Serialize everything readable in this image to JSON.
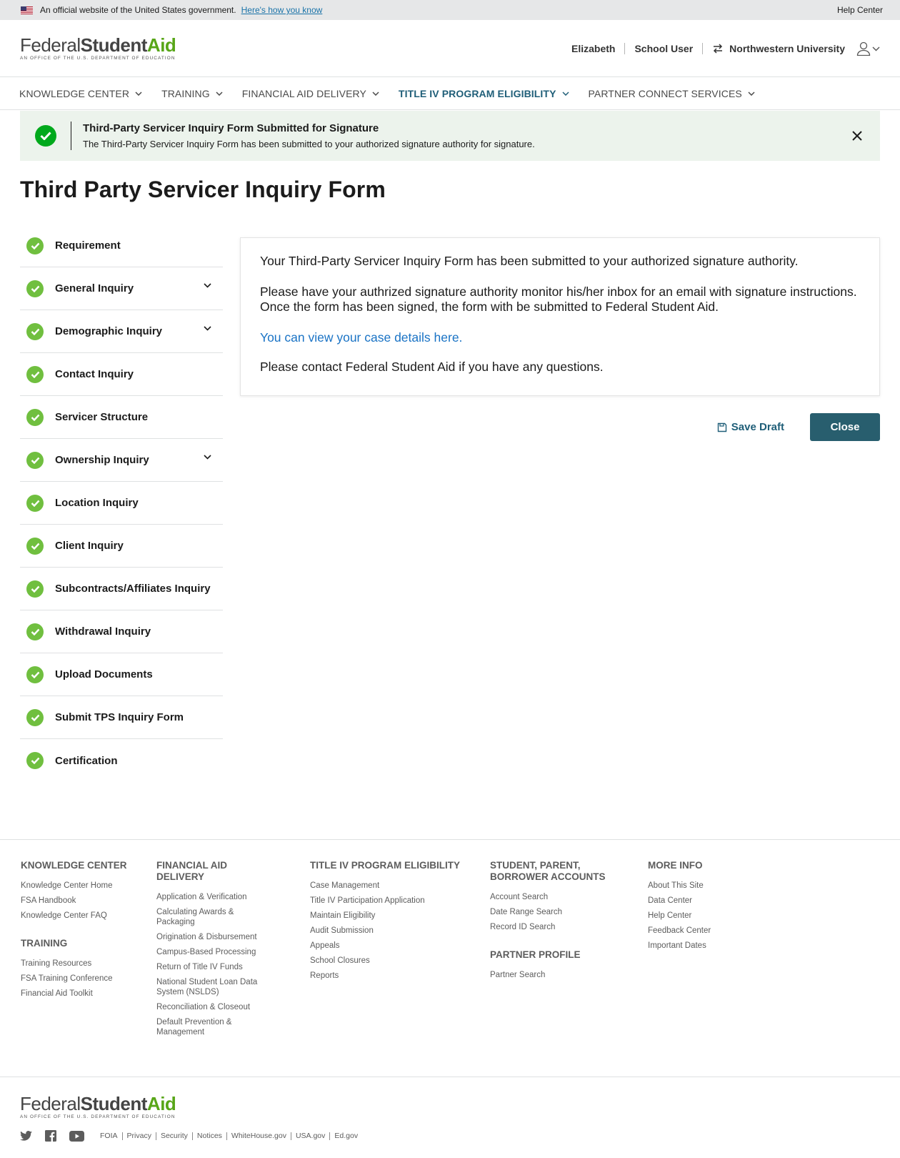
{
  "gov_banner": {
    "text": "An official website of the United States government.",
    "how_link": "Here's how you know",
    "help": "Help Center"
  },
  "logo": {
    "federal": "Federal",
    "student": "Student",
    "aid": "Aid",
    "subtitle": "An Office of the U.S. Department of Education"
  },
  "header": {
    "user": "Elizabeth",
    "role": "School User",
    "institution": "Northwestern University"
  },
  "nav": [
    {
      "label": "Knowledge Center"
    },
    {
      "label": "Training"
    },
    {
      "label": "Financial Aid Delivery"
    },
    {
      "label": "Title IV Program Eligibility",
      "active": true
    },
    {
      "label": "Partner Connect Services"
    }
  ],
  "alert": {
    "title": "Third-Party Servicer Inquiry Form Submitted for Signature",
    "body": "The Third-Party Servicer Inquiry Form has been submitted to your authorized signature authority for signature."
  },
  "page_title": "Third Party Servicer Inquiry Form",
  "steps": [
    {
      "label": "Requirement",
      "expandable": false
    },
    {
      "label": "General Inquiry",
      "expandable": true
    },
    {
      "label": "Demographic Inquiry",
      "expandable": true
    },
    {
      "label": "Contact Inquiry",
      "expandable": false
    },
    {
      "label": "Servicer Structure",
      "expandable": false
    },
    {
      "label": "Ownership Inquiry",
      "expandable": true
    },
    {
      "label": "Location Inquiry",
      "expandable": false
    },
    {
      "label": "Client Inquiry",
      "expandable": false
    },
    {
      "label": "Subcontracts/Affiliates Inquiry",
      "expandable": false
    },
    {
      "label": "Withdrawal Inquiry",
      "expandable": false
    },
    {
      "label": "Upload Documents",
      "expandable": false
    },
    {
      "label": "Submit TPS Inquiry Form",
      "expandable": false
    },
    {
      "label": "Certification",
      "expandable": false
    }
  ],
  "card": {
    "p1": "Your Third-Party Servicer Inquiry Form has been submitted to your authorized signature authority.",
    "p2": "Please have your authrized signature authority monitor his/her inbox for an email with signature instructions. Once the form has been signed, the form with be submitted to Federal Student Aid.",
    "link": "You can view your case details here.",
    "p3": "Please contact Federal Student Aid if you have any questions."
  },
  "actions": {
    "save_draft": "Save Draft",
    "close": "Close"
  },
  "footer": {
    "columns": [
      {
        "sections": [
          {
            "heading": "Knowledge Center",
            "links": [
              "Knowledge Center Home",
              "FSA Handbook",
              "Knowledge Center FAQ"
            ]
          },
          {
            "heading": "Training",
            "links": [
              "Training Resources",
              "FSA Training Conference",
              "Financial Aid Toolkit"
            ]
          }
        ]
      },
      {
        "sections": [
          {
            "heading": "Financial Aid Delivery",
            "links": [
              "Application & Verification",
              "Calculating Awards & Packaging",
              "Origination & Disbursement",
              "Campus-Based Processing",
              "Return of Title IV Funds",
              "National Student Loan Data System (NSLDS)",
              "Reconciliation & Closeout",
              "Default Prevention & Management"
            ]
          }
        ]
      },
      {
        "sections": [
          {
            "heading": "Title IV Program Eligibility",
            "links": [
              "Case Management",
              "Title IV Participation Application",
              "Maintain Eligibility",
              "Audit Submission",
              "Appeals",
              "School Closures",
              "Reports"
            ]
          }
        ]
      },
      {
        "sections": [
          {
            "heading": "Student, Parent, Borrower Accounts",
            "links": [
              "Account Search",
              "Date Range Search",
              "Record ID Search"
            ]
          },
          {
            "heading": "Partner Profile",
            "links": [
              "Partner Search"
            ]
          }
        ]
      },
      {
        "sections": [
          {
            "heading": "More Info",
            "links": [
              "About This Site",
              "Data Center",
              "Help Center",
              "Feedback Center",
              "Important Dates"
            ]
          }
        ]
      }
    ],
    "bottom_links": [
      "FOIA",
      "Privacy",
      "Security",
      "Notices",
      "WhiteHouse.gov",
      "USA.gov",
      "Ed.gov"
    ]
  },
  "colors": {
    "brand_green": "#58a618",
    "primary": "#285e6e",
    "link": "#1a73c5",
    "success": "#70bf3f"
  }
}
